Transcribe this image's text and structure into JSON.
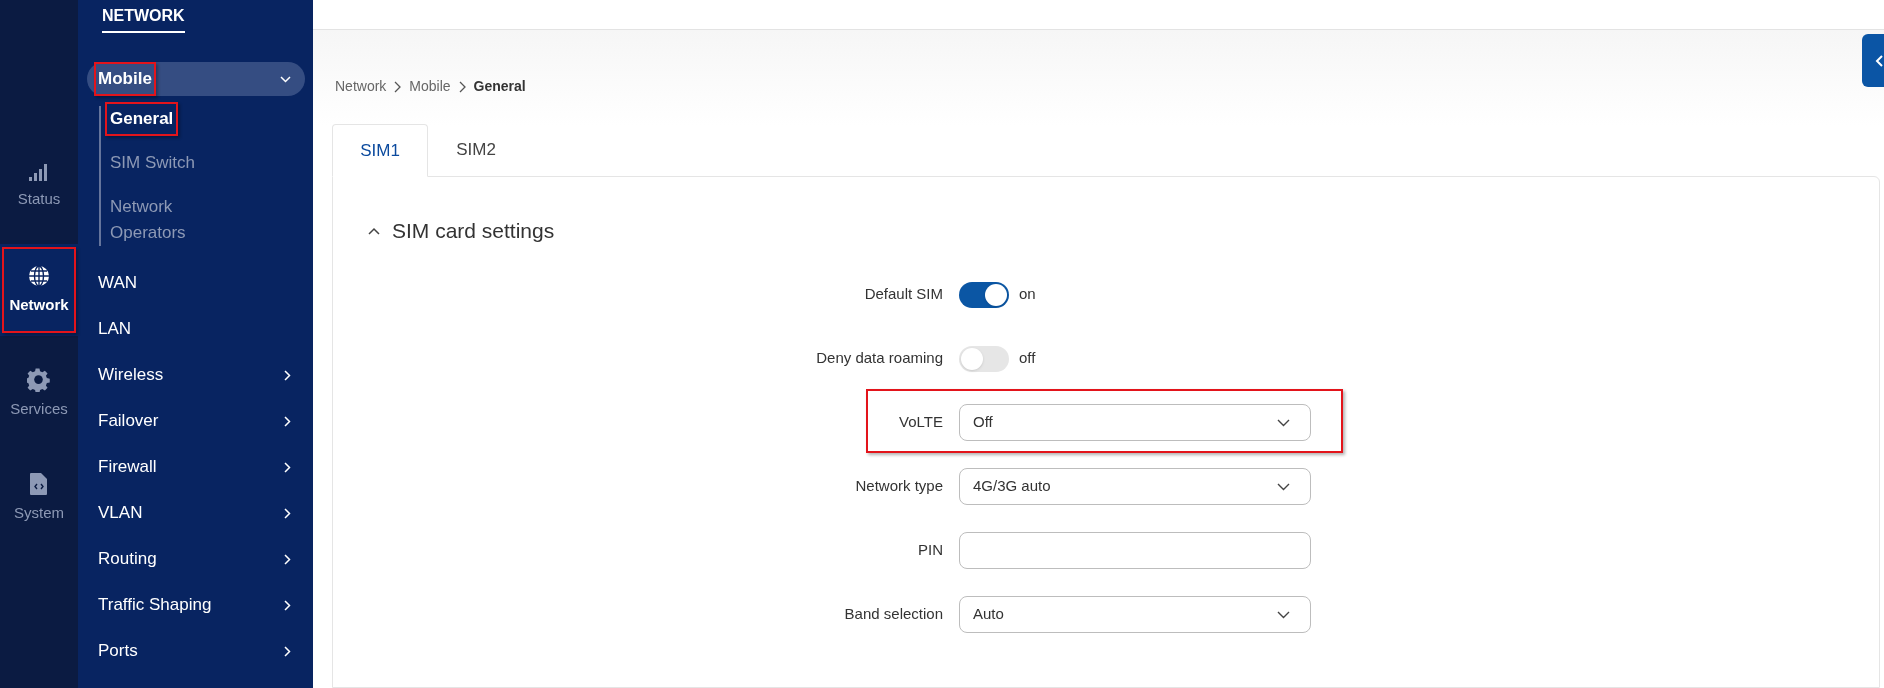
{
  "rail": [
    {
      "label": "Status",
      "selected": false,
      "highlighted": false
    },
    {
      "label": "Network",
      "selected": true,
      "highlighted": true
    },
    {
      "label": "Services",
      "selected": false,
      "highlighted": false
    },
    {
      "label": "System",
      "selected": false,
      "highlighted": false
    }
  ],
  "nav": {
    "title": "NETWORK",
    "items": [
      {
        "label": "Mobile",
        "expandable": true,
        "expanded": true,
        "highlighted": true,
        "children": [
          {
            "label": "General",
            "selected": true,
            "highlighted": true
          },
          {
            "label": "SIM Switch",
            "selected": false,
            "highlighted": false
          },
          {
            "label": "Network Operators",
            "selected": false,
            "highlighted": false
          }
        ]
      },
      {
        "label": "WAN",
        "expandable": false,
        "expanded": false,
        "highlighted": false
      },
      {
        "label": "LAN",
        "expandable": false,
        "expanded": false,
        "highlighted": false
      },
      {
        "label": "Wireless",
        "expandable": true,
        "expanded": false,
        "highlighted": false
      },
      {
        "label": "Failover",
        "expandable": true,
        "expanded": false,
        "highlighted": false
      },
      {
        "label": "Firewall",
        "expandable": true,
        "expanded": false,
        "highlighted": false
      },
      {
        "label": "VLAN",
        "expandable": true,
        "expanded": false,
        "highlighted": false
      },
      {
        "label": "Routing",
        "expandable": true,
        "expanded": false,
        "highlighted": false
      },
      {
        "label": "Traffic Shaping",
        "expandable": true,
        "expanded": false,
        "highlighted": false
      },
      {
        "label": "Ports",
        "expandable": true,
        "expanded": false,
        "highlighted": false
      }
    ]
  },
  "breadcrumb": [
    "Network",
    "Mobile",
    "General"
  ],
  "tabs": [
    {
      "label": "SIM1",
      "selected": true
    },
    {
      "label": "SIM2",
      "selected": false
    }
  ],
  "section": {
    "title": "SIM card settings",
    "expanded": true,
    "fields": [
      {
        "kind": "toggle",
        "label": "Default SIM",
        "on": true,
        "state_text": "on",
        "highlighted": false
      },
      {
        "kind": "toggle",
        "label": "Deny data roaming",
        "on": false,
        "state_text": "off",
        "highlighted": false
      },
      {
        "kind": "select",
        "label": "VoLTE",
        "value": "Off",
        "highlighted": true
      },
      {
        "kind": "select",
        "label": "Network type",
        "value": "4G/3G auto",
        "highlighted": false
      },
      {
        "kind": "text",
        "label": "PIN",
        "highlighted": false
      },
      {
        "kind": "select",
        "label": "Band selection",
        "value": "Auto",
        "highlighted": false
      }
    ]
  }
}
